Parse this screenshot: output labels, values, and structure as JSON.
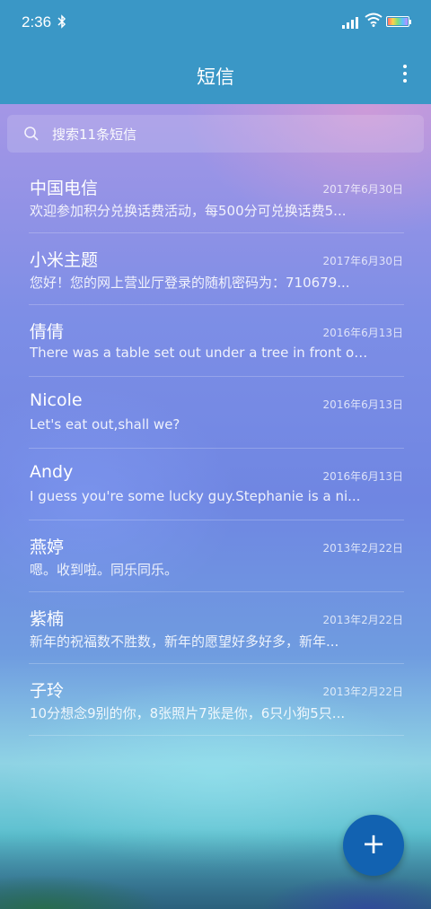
{
  "status": {
    "time": "2:36"
  },
  "app_bar": {
    "title": "短信"
  },
  "search": {
    "placeholder": "搜索11条短信"
  },
  "conversations": [
    {
      "name": "中国电信",
      "date": "2017年6月30日",
      "preview": "欢迎参加积分兑换话费活动，每500分可兑换话费5..."
    },
    {
      "name": "小米主题",
      "date": "2017年6月30日",
      "preview": "您好！您的网上营业厅登录的随机密码为：710679..."
    },
    {
      "name": "倩倩",
      "date": "2016年6月13日",
      "preview": "There was a table set out under a tree in front of ..."
    },
    {
      "name": "Nicole",
      "date": "2016年6月13日",
      "preview": "Let's eat out,shall we?"
    },
    {
      "name": "Andy",
      "date": "2016年6月13日",
      "preview": "I guess you're some lucky guy.Stephanie is a ni..."
    },
    {
      "name": "燕婷",
      "date": "2013年2月22日",
      "preview": "嗯。收到啦。同乐同乐。"
    },
    {
      "name": "紫楠",
      "date": "2013年2月22日",
      "preview": "新年的祝福数不胜数，新年的愿望好多好多，新年..."
    },
    {
      "name": "子玲",
      "date": "2013年2月22日",
      "preview": "10分想念9别的你，8张照片7张是你，6只小狗5只..."
    }
  ],
  "fab": {
    "icon": "plus-icon",
    "label": "+"
  },
  "colors": {
    "app_bar": "#3a97c6",
    "fab": "#1262b1"
  }
}
